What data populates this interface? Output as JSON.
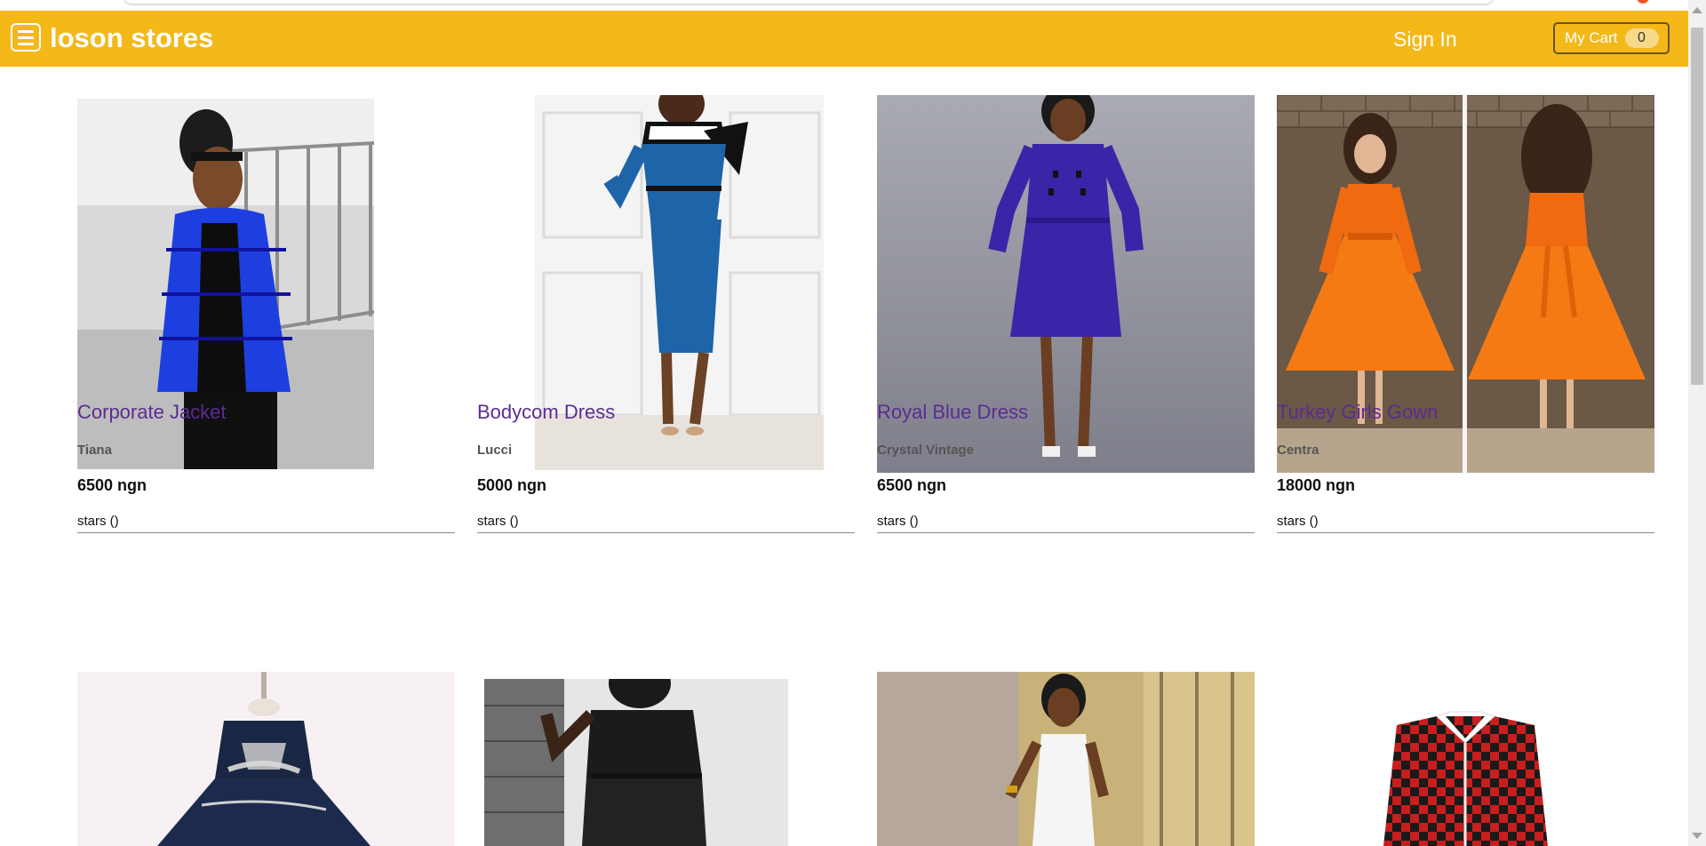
{
  "header": {
    "brand": "loson stores",
    "signin_label": "Sign In",
    "cart_label": "My Cart",
    "cart_count": "0",
    "accent_color": "#f4b819"
  },
  "products": [
    {
      "name": "Corporate Jacket",
      "brand": "Tiana",
      "price": "6500 ngn",
      "stars": "stars ()"
    },
    {
      "name": "Bodycom Dress",
      "brand": "Lucci",
      "price": "5000 ngn",
      "stars": "stars ()"
    },
    {
      "name": "Royal Blue Dress",
      "brand": "Crystal Vintage",
      "price": "6500 ngn",
      "stars": "stars ()"
    },
    {
      "name": "Turkey Girls Gown",
      "brand": "Centra",
      "price": "18000 ngn",
      "stars": "stars ()"
    }
  ],
  "icons": {
    "menu": "hamburger-menu-icon"
  }
}
